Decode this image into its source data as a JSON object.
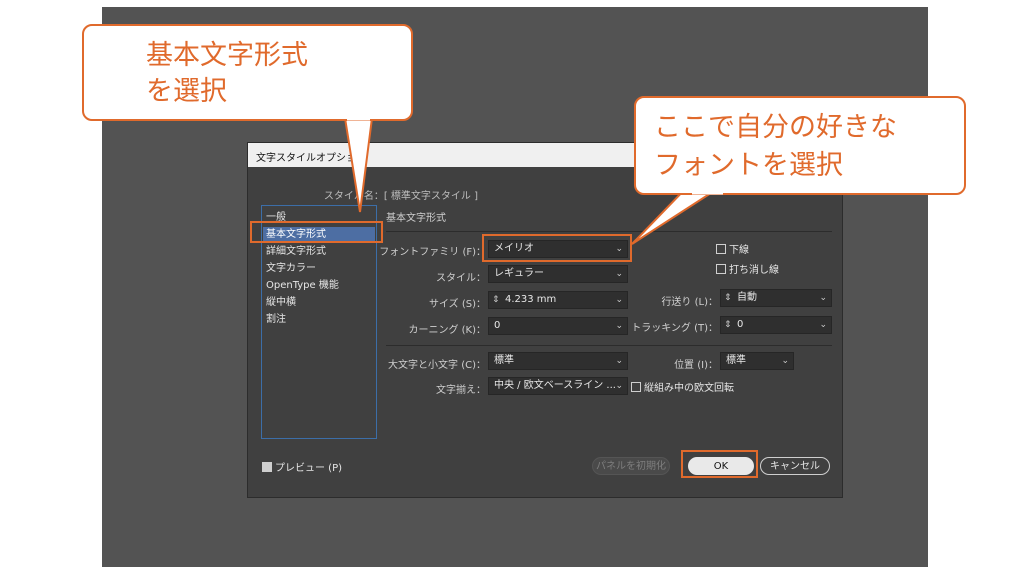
{
  "colors": {
    "accent": "#e06a2c",
    "selection": "#4d6ea3",
    "dialog_bg": "#404040"
  },
  "dialog": {
    "title": "文字スタイルオプション",
    "style_name_label": "スタイル名：",
    "style_name_value": "[ 標準文字スタイル ]",
    "sidebar": {
      "items": [
        {
          "label": "一般"
        },
        {
          "label": "基本文字形式"
        },
        {
          "label": "詳細文字形式"
        },
        {
          "label": "文字カラー"
        },
        {
          "label": "OpenType 機能"
        },
        {
          "label": "縦中横"
        },
        {
          "label": "割注"
        }
      ]
    },
    "section_title": "基本文字形式",
    "fields": {
      "font_family": {
        "label": "フォントファミリ (F)：",
        "value": "メイリオ"
      },
      "style": {
        "label": "スタイル：",
        "value": "レギュラー"
      },
      "size": {
        "label": "サイズ (S)：",
        "value": "4.233 mm"
      },
      "kerning": {
        "label": "カーニング (K)：",
        "value": "0"
      },
      "leading": {
        "label": "行送り (L)：",
        "value": "自動"
      },
      "tracking": {
        "label": "トラッキング (T)：",
        "value": "0"
      },
      "case": {
        "label": "大文字と小文字 (C)：",
        "value": "標準"
      },
      "position": {
        "label": "位置 (I)：",
        "value": "標準"
      },
      "alignment": {
        "label": "文字揃え：",
        "value": "中央 / 欧文ベースライン ..."
      }
    },
    "checkboxes": {
      "underline": "下線",
      "strikethrough": "打ち消し線",
      "rotate_roman": "縦組み中の欧文回転",
      "preview": "プレビュー (P)"
    },
    "buttons": {
      "reset": "パネルを初期化",
      "ok": "OK",
      "cancel": "キャンセル"
    }
  },
  "callouts": {
    "left_line1": "基本文字形式",
    "left_line2": "を選択",
    "right_line1": "ここで自分の好きな",
    "right_line2": "フォントを選択"
  }
}
